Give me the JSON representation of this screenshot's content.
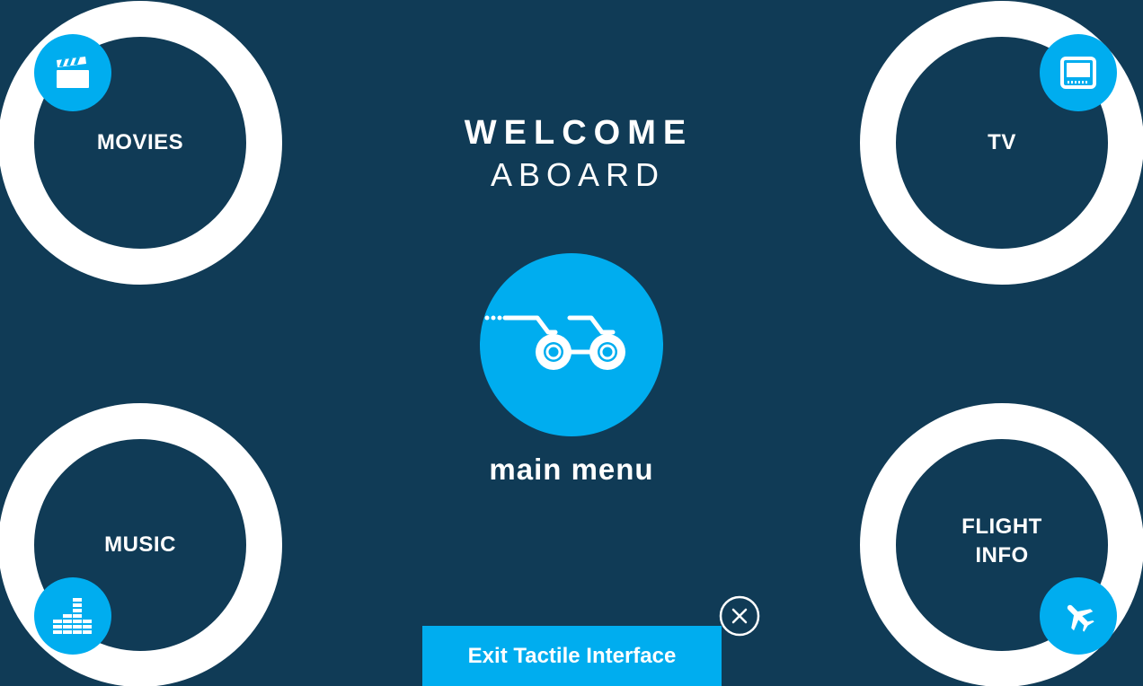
{
  "welcome": {
    "line1": "WELCOME",
    "line2": "ABOARD"
  },
  "menu": {
    "movies": {
      "label": "MOVIES",
      "icon": "clapperboard-icon"
    },
    "tv": {
      "label": "TV",
      "icon": "tv-icon"
    },
    "music": {
      "label": "MUSIC",
      "icon": "equalizer-icon"
    },
    "flight": {
      "label_line1": "FLIGHT",
      "label_line2": "INFO",
      "icon": "airplane-icon"
    }
  },
  "main_menu": {
    "label": "main menu",
    "icon": "binoculars-icon"
  },
  "exit": {
    "label": "Exit Tactile Interface",
    "close_icon": "close-icon"
  },
  "colors": {
    "background": "#103b56",
    "accent": "#00adef",
    "ring": "#ffffff",
    "text": "#ffffff"
  }
}
